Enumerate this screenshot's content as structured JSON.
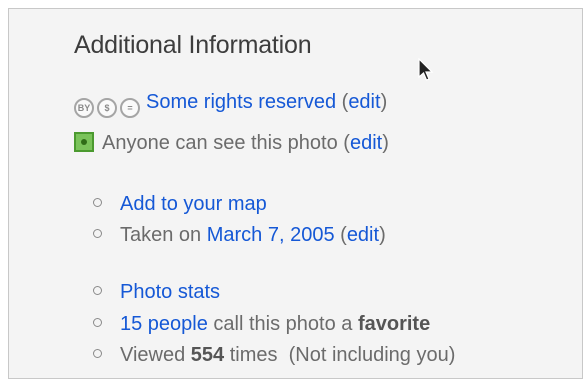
{
  "section": {
    "title": "Additional Information"
  },
  "license": {
    "icons": [
      "cc-by-icon",
      "cc-nc-icon",
      "cc-nd-icon"
    ],
    "link": "Some rights reserved",
    "edit_open": "(",
    "edit": "edit",
    "edit_close": ")"
  },
  "privacy": {
    "text": "Anyone can see this photo (",
    "edit": "edit",
    "close": ")"
  },
  "map_list": {
    "add_to_map": "Add to your map",
    "taken_prefix": "Taken on ",
    "taken_date": "March 7, 2005",
    "taken_open": " (",
    "taken_edit": "edit",
    "taken_close": ")"
  },
  "stats_list": {
    "photo_stats": "Photo stats",
    "favorites_count": "15 people",
    "favorites_mid": " call this photo a ",
    "favorites_word": "favorite",
    "viewed_prefix": "Viewed ",
    "viewed_count": "554",
    "viewed_suffix": " times  (Not including you)"
  },
  "colors": {
    "link": "#1558d6",
    "text": "#6b6b6b",
    "panel_bg": "#f4f4f4",
    "privacy_green": "#7ac35a"
  }
}
